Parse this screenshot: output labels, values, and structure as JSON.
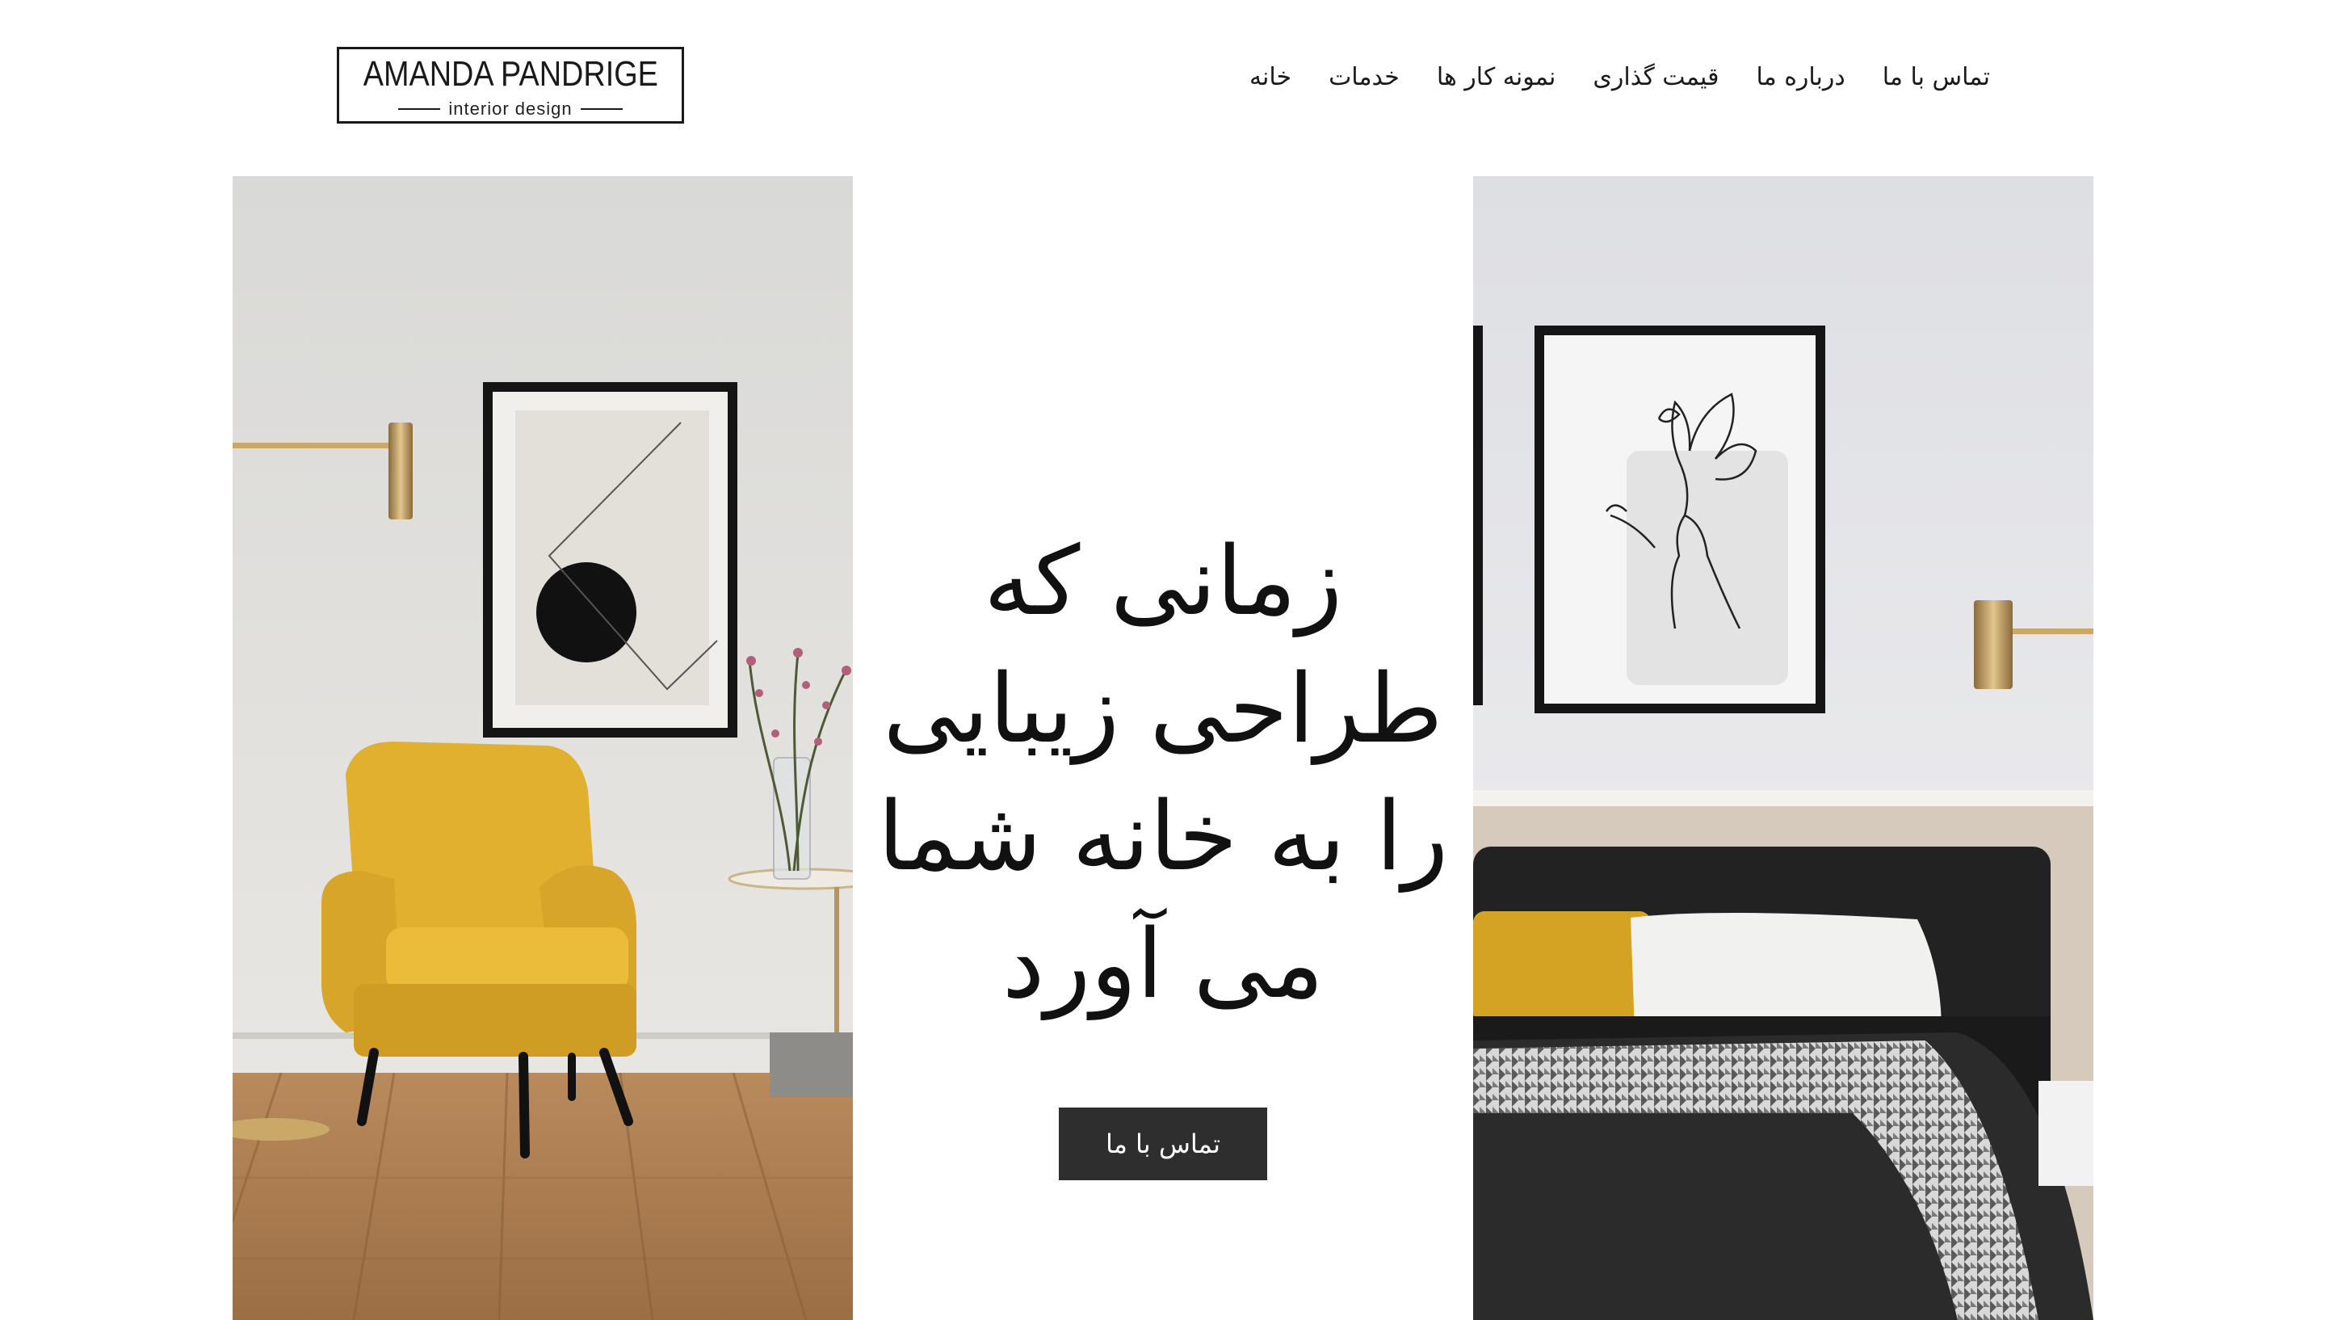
{
  "logo": {
    "name": "AMANDA PANDRIGE",
    "tagline": "interior design"
  },
  "nav": {
    "items": [
      {
        "label": "تماس با ما"
      },
      {
        "label": "درباره ما"
      },
      {
        "label": "قیمت گذاری"
      },
      {
        "label": "نمونه کار ها"
      },
      {
        "label": "خدمات"
      },
      {
        "label": "خانه"
      }
    ]
  },
  "hero": {
    "title_lines": [
      "زمانی که",
      "طراحی زیبایی",
      "را به خانه شما",
      "می آورد"
    ],
    "cta_label": "تماس با ما"
  },
  "colors": {
    "accent_yellow": "#e6b630",
    "button_bg": "#2e2e2e",
    "text": "#1a1a1a",
    "background": "#ffffff"
  }
}
